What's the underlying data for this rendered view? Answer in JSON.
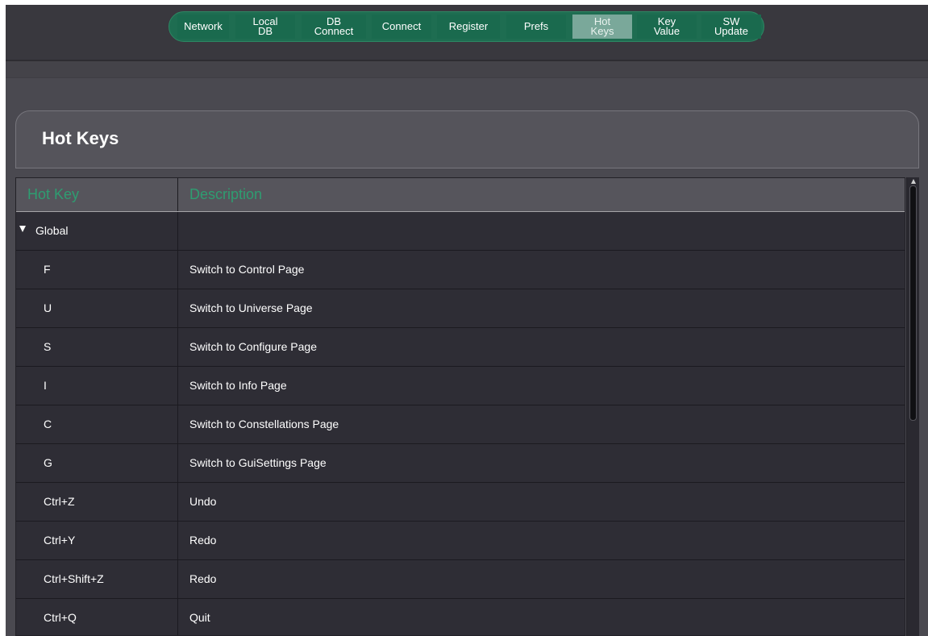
{
  "nav": {
    "tabs": [
      {
        "label": "Network"
      },
      {
        "label": "Local\nDB"
      },
      {
        "label": "DB\nConnect"
      },
      {
        "label": "Connect"
      },
      {
        "label": "Register"
      },
      {
        "label": "Prefs"
      },
      {
        "label": "Hot\nKeys"
      },
      {
        "label": "Key\nValue"
      },
      {
        "label": "SW\nUpdate"
      }
    ],
    "active_tab": "Hot\nKeys",
    "accent_color": "#1e6d51",
    "active_color": "#7aa89a"
  },
  "panel": {
    "title": "Hot Keys"
  },
  "table": {
    "columns": {
      "hotkey": "Hot Key",
      "description": "Description"
    },
    "header_color": "#2e9d71",
    "group": {
      "label": "Global",
      "expanded": true
    },
    "rows": [
      {
        "key": "F",
        "description": "Switch to Control Page"
      },
      {
        "key": "U",
        "description": "Switch to Universe Page"
      },
      {
        "key": "S",
        "description": "Switch to Configure Page"
      },
      {
        "key": "I",
        "description": "Switch to Info Page"
      },
      {
        "key": "C",
        "description": "Switch to Constellations Page"
      },
      {
        "key": "G",
        "description": "Switch to GuiSettings Page"
      },
      {
        "key": "Ctrl+Z",
        "description": "Undo"
      },
      {
        "key": "Ctrl+Y",
        "description": "Redo"
      },
      {
        "key": "Ctrl+Shift+Z",
        "description": "Redo"
      },
      {
        "key": "Ctrl+Q",
        "description": "Quit"
      }
    ]
  }
}
